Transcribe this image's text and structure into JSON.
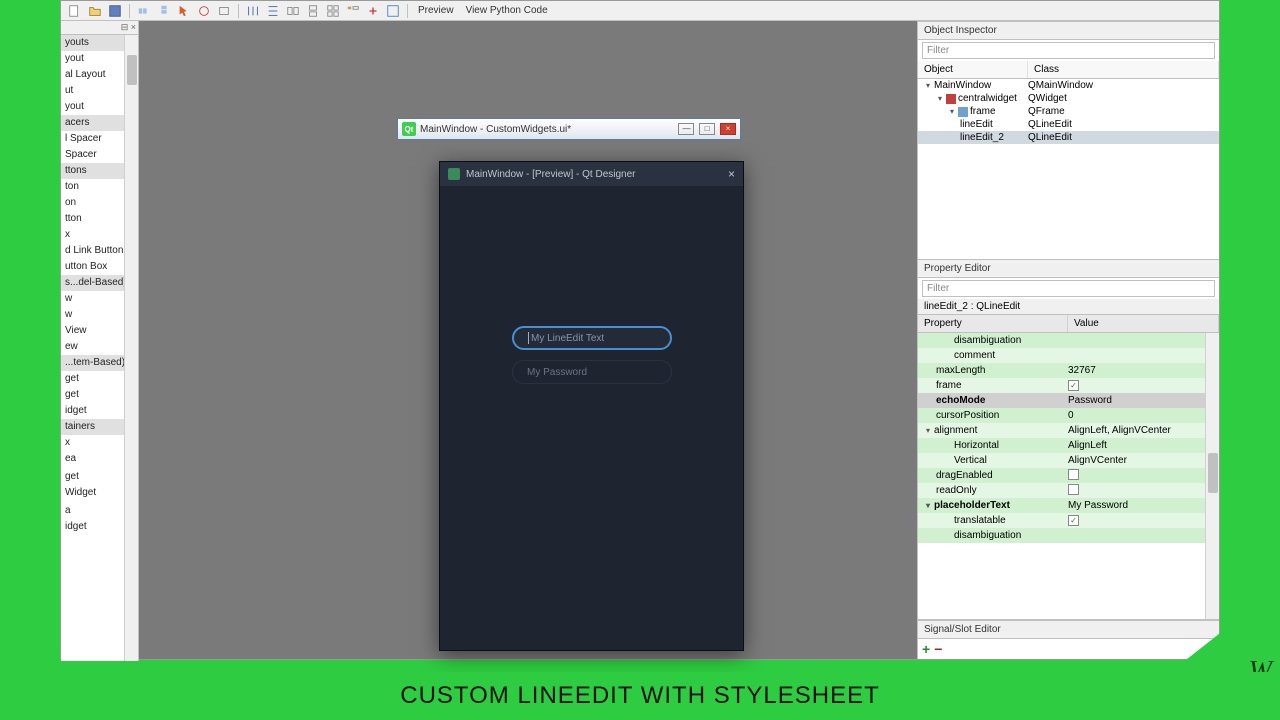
{
  "toolbar": {
    "preview": "Preview",
    "view_code": "View Python Code"
  },
  "widget_box": {
    "close_glyph": "⊟ ×",
    "items": [
      {
        "t": "youts",
        "cat": true
      },
      {
        "t": "yout"
      },
      {
        "t": "al Layout"
      },
      {
        "t": "ut"
      },
      {
        "t": "yout"
      },
      {
        "t": "acers",
        "cat": true
      },
      {
        "t": "l Spacer"
      },
      {
        "t": "Spacer"
      },
      {
        "t": "ttons",
        "cat": true
      },
      {
        "t": "ton"
      },
      {
        "t": "on"
      },
      {
        "t": "tton"
      },
      {
        "t": "x"
      },
      {
        "t": "d Link Button"
      },
      {
        "t": "utton Box"
      },
      {
        "t": "s...del-Based)",
        "cat": true
      },
      {
        "t": "w"
      },
      {
        "t": "w"
      },
      {
        "t": "View"
      },
      {
        "t": "ew"
      },
      {
        "t": "...tem-Based)",
        "cat": true
      },
      {
        "t": "get"
      },
      {
        "t": "get"
      },
      {
        "t": "idget"
      },
      {
        "t": "tainers",
        "cat": true
      },
      {
        "t": "x"
      },
      {
        "t": "ea"
      },
      {
        "t": ""
      },
      {
        "t": "get"
      },
      {
        "t": "Widget"
      },
      {
        "t": ""
      },
      {
        "t": "a"
      },
      {
        "t": "idget"
      }
    ]
  },
  "editor_window": {
    "title": "MainWindow - CustomWidgets.ui*"
  },
  "preview_window": {
    "title": "MainWindow - [Preview] - Qt Designer",
    "lineedit1_placeholder": "My LineEdit Text",
    "lineedit2_placeholder": "My Password"
  },
  "object_inspector": {
    "title": "Object Inspector",
    "filter": "Filter",
    "col1": "Object",
    "col2": "Class",
    "rows": [
      {
        "indent": 0,
        "exp": "v",
        "name": "MainWindow",
        "cls": "QMainWindow"
      },
      {
        "indent": 1,
        "exp": "v",
        "name": "centralwidget",
        "cls": "QWidget",
        "icon": "layout"
      },
      {
        "indent": 2,
        "exp": "v",
        "name": "frame",
        "cls": "QFrame",
        "icon": "frame"
      },
      {
        "indent": 3,
        "name": "lineEdit",
        "cls": "QLineEdit"
      },
      {
        "indent": 3,
        "name": "lineEdit_2",
        "cls": "QLineEdit",
        "selected": true
      }
    ]
  },
  "property_editor": {
    "title": "Property Editor",
    "filter": "Filter",
    "target": "lineEdit_2 : QLineEdit",
    "col1": "Property",
    "col2": "Value",
    "rows": [
      {
        "name": "disambiguation",
        "val": "",
        "child": true,
        "g": 0
      },
      {
        "name": "comment",
        "val": "",
        "child": true,
        "g": 1
      },
      {
        "name": "maxLength",
        "val": "32767",
        "g": 0
      },
      {
        "name": "frame",
        "val": "[x]",
        "g": 1,
        "check": true,
        "checked": true
      },
      {
        "name": "echoMode",
        "val": "Password",
        "bold": true,
        "sel": true
      },
      {
        "name": "cursorPosition",
        "val": "0",
        "g": 0
      },
      {
        "name": "alignment",
        "val": "AlignLeft, AlignVCenter",
        "g": 1,
        "exp": "v"
      },
      {
        "name": "Horizontal",
        "val": "AlignLeft",
        "child": true,
        "g": 0
      },
      {
        "name": "Vertical",
        "val": "AlignVCenter",
        "child": true,
        "g": 1
      },
      {
        "name": "dragEnabled",
        "val": "",
        "g": 0,
        "check": true,
        "checked": false
      },
      {
        "name": "readOnly",
        "val": "",
        "g": 1,
        "check": true,
        "checked": false
      },
      {
        "name": "placeholderText",
        "val": "My Password",
        "bold": true,
        "g": 0,
        "exp": "v"
      },
      {
        "name": "translatable",
        "val": "",
        "child": true,
        "g": 1,
        "check": true,
        "checked": true
      },
      {
        "name": "disambiguation",
        "val": "",
        "child": true,
        "g": 0
      }
    ]
  },
  "signal_editor": {
    "title": "Signal/Slot Editor"
  },
  "caption": "CUSTOM LINEEDIT WITH STYLESHEET",
  "logo": "W"
}
